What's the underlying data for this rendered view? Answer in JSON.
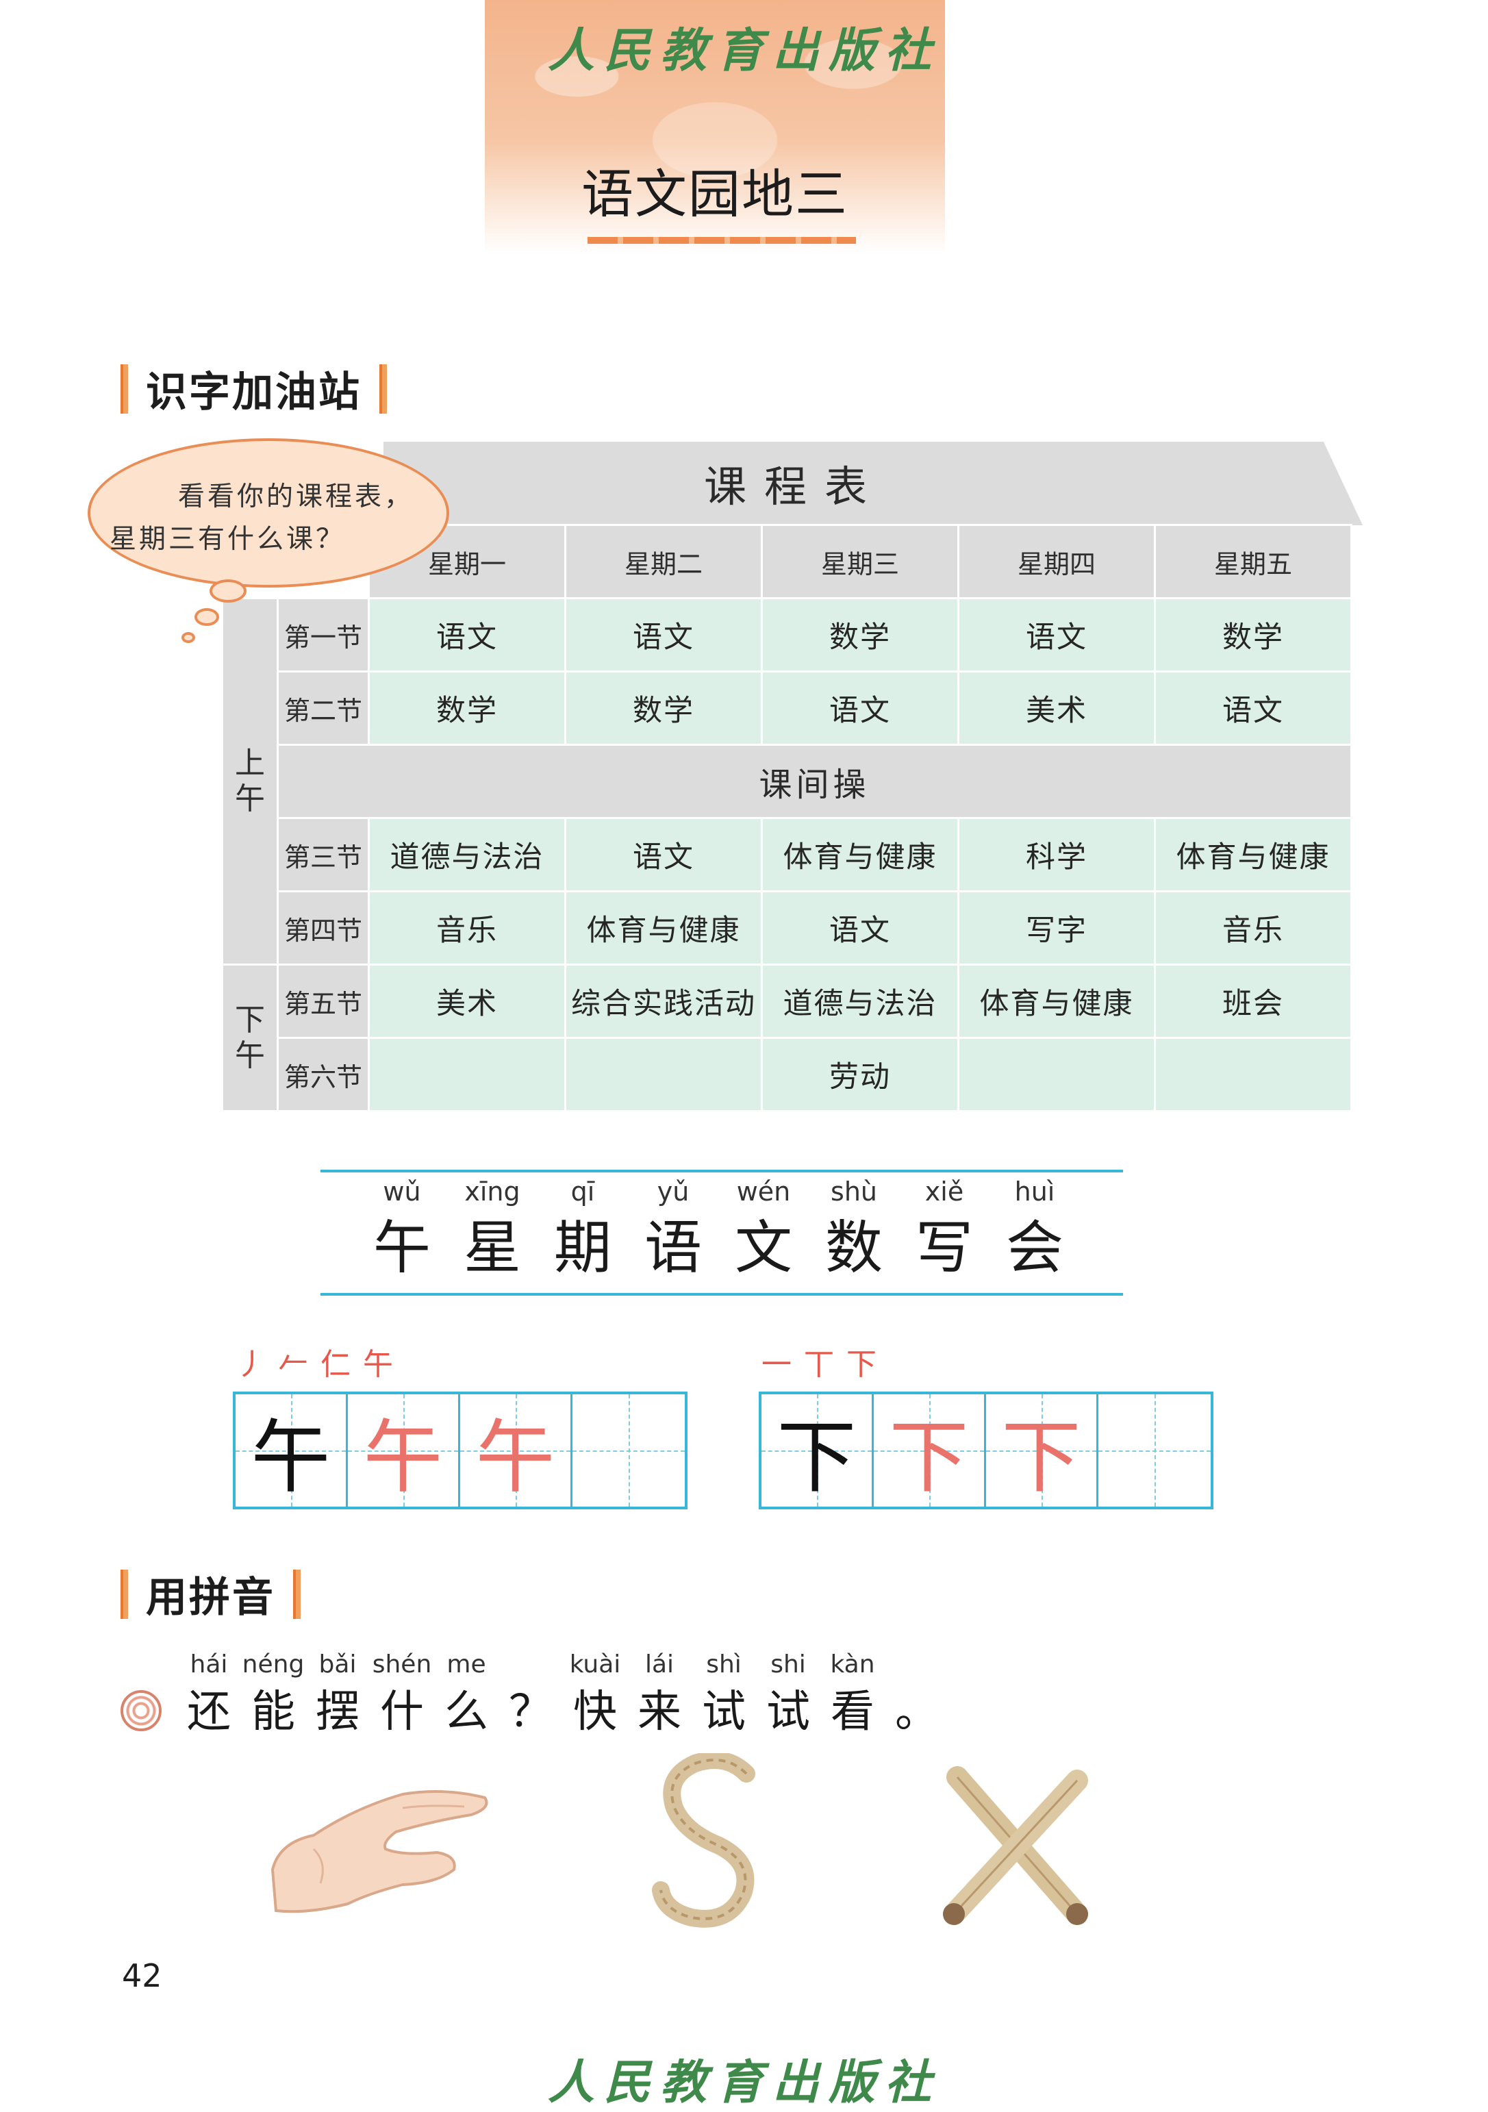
{
  "header": {
    "publisher": "人民教育出版社",
    "unit_title": "语文园地三"
  },
  "section1": {
    "title": "识字加油站"
  },
  "schedule": {
    "title": "课程表",
    "days": [
      "星期一",
      "星期二",
      "星期三",
      "星期四",
      "星期五"
    ],
    "sessions": {
      "morning": "上午",
      "afternoon": "下午"
    },
    "rows": [
      {
        "period": "第一节",
        "classes": [
          "语文",
          "语文",
          "数学",
          "语文",
          "数学"
        ]
      },
      {
        "period": "第二节",
        "classes": [
          "数学",
          "数学",
          "语文",
          "美术",
          "语文"
        ]
      },
      {
        "period": "第三节",
        "classes": [
          "道德与法治",
          "语文",
          "体育与健康",
          "科学",
          "体育与健康"
        ]
      },
      {
        "period": "第四节",
        "classes": [
          "音乐",
          "体育与健康",
          "语文",
          "写字",
          "音乐"
        ]
      },
      {
        "period": "第五节",
        "classes": [
          "美术",
          "综合实践活动",
          "道德与法治",
          "体育与健康",
          "班会"
        ]
      },
      {
        "period": "第六节",
        "classes": [
          "",
          "",
          "劳动",
          "",
          ""
        ]
      }
    ],
    "break": "课间操"
  },
  "bubble": {
    "line1": "看看你的课程表，",
    "line2": "星期三有什么课？"
  },
  "new_chars": [
    {
      "pinyin": "wǔ",
      "hanzi": "午"
    },
    {
      "pinyin": "xīng",
      "hanzi": "星"
    },
    {
      "pinyin": "qī",
      "hanzi": "期"
    },
    {
      "pinyin": "yǔ",
      "hanzi": "语"
    },
    {
      "pinyin": "wén",
      "hanzi": "文"
    },
    {
      "pinyin": "shù",
      "hanzi": "数"
    },
    {
      "pinyin": "xiě",
      "hanzi": "写"
    },
    {
      "pinyin": "huì",
      "hanzi": "会"
    }
  ],
  "writing": [
    {
      "strokes": "丿 𠂉 仁 午",
      "char": "午"
    },
    {
      "strokes": "一 丅 下",
      "char": "下"
    }
  ],
  "section2": {
    "title": "用拼音"
  },
  "sentence": [
    {
      "pinyin": "hái",
      "hanzi": "还"
    },
    {
      "pinyin": "néng",
      "hanzi": "能"
    },
    {
      "pinyin": "bǎi",
      "hanzi": "摆"
    },
    {
      "pinyin": "shén",
      "hanzi": "什"
    },
    {
      "pinyin": "me",
      "hanzi": "么"
    },
    {
      "pinyin": "",
      "hanzi": "？"
    },
    {
      "pinyin": "kuài",
      "hanzi": "快"
    },
    {
      "pinyin": "lái",
      "hanzi": "来"
    },
    {
      "pinyin": "shì",
      "hanzi": "试"
    },
    {
      "pinyin": "shi",
      "hanzi": "试"
    },
    {
      "pinyin": "kàn",
      "hanzi": "看"
    },
    {
      "pinyin": "",
      "hanzi": "。"
    }
  ],
  "illustrations": [
    "hand-c-shape",
    "rope-s-shape",
    "crossed-sticks-x-shape"
  ],
  "colors": {
    "accent": "#e8772f",
    "cyan": "#38b6d8",
    "table_green": "#dcf0e8",
    "table_gray": "#dcdcdd",
    "trace_red": "#e9726a"
  },
  "page_number": "42"
}
